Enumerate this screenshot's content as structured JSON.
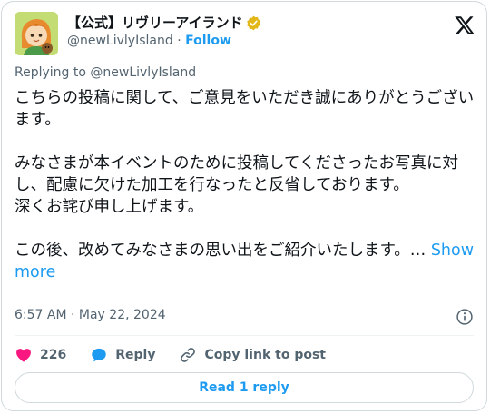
{
  "author": {
    "display_name": "【公式】リヴリーアイランド",
    "handle": "@newLivlyIsland",
    "separator": "·",
    "follow_label": "Follow",
    "verified": true,
    "badge_color": "#e2b719"
  },
  "reply_to": {
    "prefix": "Replying to ",
    "handle": "@newLivlyIsland"
  },
  "tweet": {
    "text": "こちらの投稿に関して、ご意見をいただき誠にありがとうございます。\n\nみなさまが本イベントのために投稿してくださったお写真に対し、配慮に欠けた加工を行なったと反省しております。\n深くお詫び申し上げます。\n\nこの後、改めてみなさまの思い出をご紹介いたします。…",
    "show_more_label": "Show more",
    "timestamp": "6:57 AM · May 22, 2024"
  },
  "actions": {
    "like_count": "226",
    "reply_label": "Reply",
    "copy_label": "Copy link to post"
  },
  "read_replies_label": "Read 1 reply",
  "colors": {
    "accent": "#1d9bf0",
    "like": "#f91880",
    "secondary_text": "#536471",
    "border": "#cfd9de"
  },
  "icons": {
    "brand": "x-logo-icon",
    "verified": "verified-badge-icon",
    "info": "info-icon",
    "like": "heart-icon",
    "reply": "reply-bubble-icon",
    "copy": "link-icon"
  }
}
